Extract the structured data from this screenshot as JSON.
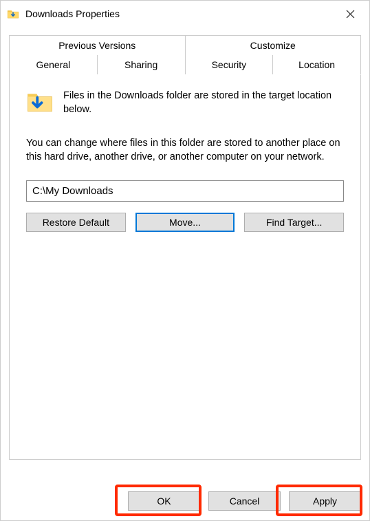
{
  "window": {
    "title": "Downloads Properties"
  },
  "tabs": {
    "row1": [
      {
        "label": "Previous Versions",
        "active": false
      },
      {
        "label": "Customize",
        "active": false
      }
    ],
    "row2": [
      {
        "label": "General",
        "active": false
      },
      {
        "label": "Sharing",
        "active": false
      },
      {
        "label": "Security",
        "active": false
      },
      {
        "label": "Location",
        "active": true
      }
    ]
  },
  "body": {
    "desc1": "Files in the Downloads folder are stored in the target location below.",
    "desc2": "You can change where files in this folder are stored to another place on this hard drive, another drive, or another computer on your network.",
    "path_value": "C:\\My Downloads",
    "restore_label": "Restore Default",
    "move_label": "Move...",
    "find_label": "Find Target..."
  },
  "footer": {
    "ok_label": "OK",
    "cancel_label": "Cancel",
    "apply_label": "Apply"
  },
  "icons": {
    "title_icon": "downloads-folder-icon",
    "body_icon": "downloads-folder-icon",
    "close": "close-icon"
  }
}
